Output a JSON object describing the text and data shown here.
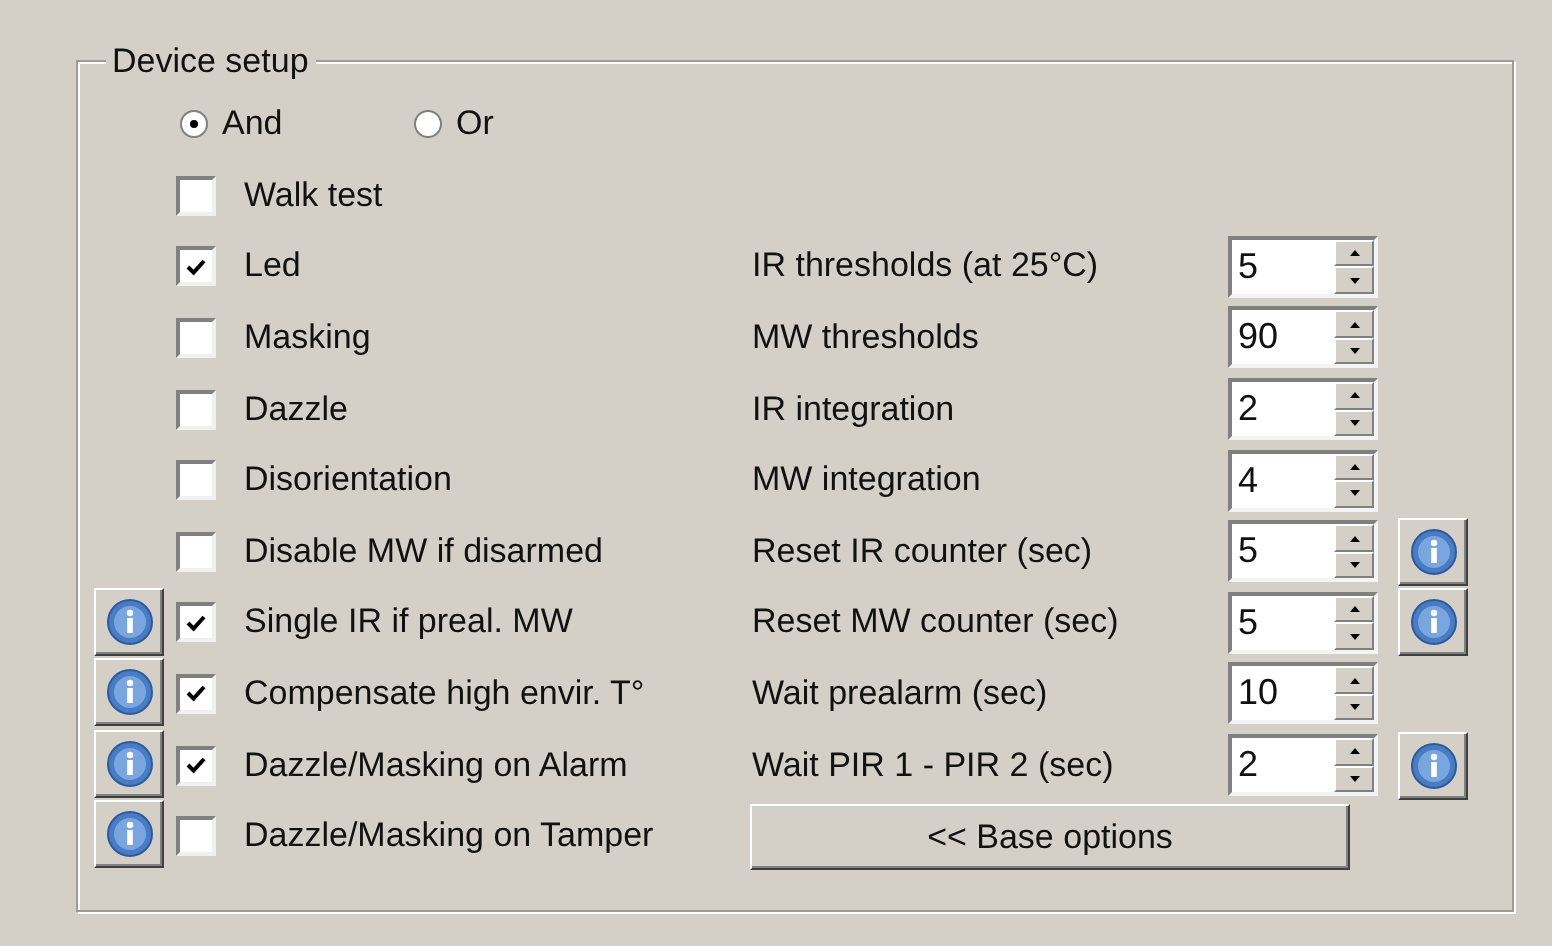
{
  "group": {
    "title": "Device setup"
  },
  "logic": [
    {
      "label": "And",
      "selected": true
    },
    {
      "label": "Or",
      "selected": false
    }
  ],
  "options": [
    {
      "label": "Walk test",
      "checked": false,
      "info": false
    },
    {
      "label": "Led",
      "checked": true,
      "info": false
    },
    {
      "label": "Masking",
      "checked": false,
      "info": false
    },
    {
      "label": "Dazzle",
      "checked": false,
      "info": false
    },
    {
      "label": "Disorientation",
      "checked": false,
      "info": false
    },
    {
      "label": "Disable MW if disarmed",
      "checked": false,
      "info": false
    },
    {
      "label": "Single IR if preal. MW",
      "checked": true,
      "info": true
    },
    {
      "label": "Compensate high envir. T°",
      "checked": true,
      "info": true
    },
    {
      "label": "Dazzle/Masking on Alarm",
      "checked": true,
      "info": true
    },
    {
      "label": "Dazzle/Masking on Tamper",
      "checked": false,
      "info": true
    }
  ],
  "settings": [
    {
      "label": "IR thresholds (at 25°C)",
      "value": "5",
      "info": false
    },
    {
      "label": "MW thresholds",
      "value": "90",
      "info": false
    },
    {
      "label": "IR integration",
      "value": "2",
      "info": false
    },
    {
      "label": "MW integration",
      "value": "4",
      "info": false
    },
    {
      "label": "Reset IR counter (sec)",
      "value": "5",
      "info": true
    },
    {
      "label": "Reset MW counter (sec)",
      "value": "5",
      "info": true
    },
    {
      "label": "Wait prealarm (sec)",
      "value": "10",
      "info": false
    },
    {
      "label": "Wait PIR 1 - PIR 2 (sec)",
      "value": "2",
      "info": true
    }
  ],
  "base_button": "<< Base options"
}
